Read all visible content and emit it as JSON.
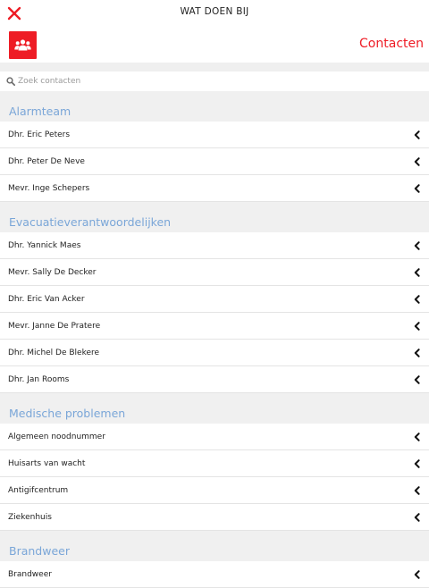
{
  "top_bar": {
    "title": "WAT DOEN BIJ",
    "close_icon": "close-icon",
    "accent": "#ee1c25"
  },
  "header": {
    "logo_icon": "group-icon",
    "heading": "Contacten"
  },
  "search": {
    "placeholder": "Zoek contacten",
    "value": ""
  },
  "sections": [
    {
      "title": "Alarmteam",
      "items": [
        "Dhr. Eric Peters",
        "Dhr. Peter De Neve",
        "Mevr. Inge Schepers"
      ]
    },
    {
      "title": "Evacuatieverantwoordelijken",
      "items": [
        "Dhr. Yannick Maes",
        "Mevr. Sally De Decker",
        "Dhr. Eric Van Acker",
        "Mevr. Janne De Pratere",
        "Dhr. Michel De Blekere",
        "Dhr. Jan Rooms"
      ]
    },
    {
      "title": "Medische problemen",
      "items": [
        "Algemeen noodnummer",
        "Huisarts van wacht",
        "Antigifcentrum",
        "Ziekenhuis"
      ]
    },
    {
      "title": "Brandweer",
      "items": [
        "Brandweer"
      ]
    }
  ],
  "row_icon": "chevron-left-icon",
  "colors": {
    "section_title": "#7aa6d8",
    "background": "#f0f0f0"
  }
}
